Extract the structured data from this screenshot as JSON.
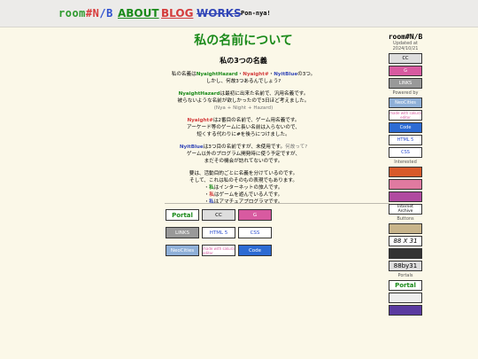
{
  "header": {
    "logo": [
      "room",
      "#N",
      "/B"
    ],
    "nav": [
      "ABOUT",
      "BLOG",
      "WORKS"
    ],
    "tagline": "Pon-nya!"
  },
  "main": {
    "title": "私の名前について",
    "subtitle": "私の3つの名義",
    "p1": [
      "私の名義は",
      "NyaightHazard",
      "・",
      "Nyaight#",
      "・",
      "NyitBlue",
      "の3つ。"
    ],
    "p1b": "しかし、何故3つあるんでしょう?",
    "p2a": [
      "NyaightHazard",
      "は最初に出来た名前で、汎用名義です。"
    ],
    "p2b": "被らないような名前が欲しかったので3日ほど考えました。",
    "p2c": "(Nya + Night + Hazard)",
    "p3a": [
      "Nyaight#",
      "は2番目の名前で、ゲーム用名義です。"
    ],
    "p3b": "アーケード等のゲームに長い名前は入らないので、",
    "p3c": "短くする代わりに#を後ろにつけました。",
    "p4a": [
      "NyitBlue",
      "は3つ目の名前ですが、未使用です。",
      "何故って?"
    ],
    "p4b": "ゲーム以外のプログラム開発時に使う予定ですが、",
    "p4c": "まだその機会が訪れてないのです。",
    "p5a": "要は、活動目的ごとに名義を分けているのです。",
    "p5b": "そして、これは私のそのもの表現でもあります。",
    "p5c": [
      "・",
      "私",
      "はインターネットの旅人です。"
    ],
    "p5d": [
      "・",
      "私",
      "はゲームを遊んでいる人です。"
    ],
    "p5e": [
      "・",
      "私",
      "はアマチュアプログラマです。"
    ]
  },
  "badges": [
    "Portal",
    "CC",
    "G",
    "LINKS",
    "HTML 5",
    "CSS",
    "NeoCities",
    "made with sakura editor",
    "Code"
  ],
  "sidebar": {
    "logo": "room#N/B",
    "updated_label": "Updated at",
    "updated_date": "2024/10/21",
    "powered_by": "Powered by",
    "interested": "Interested",
    "buttons": "Buttons",
    "portals": "Portals",
    "button_labels": [
      "88 X 31",
      "88by31"
    ],
    "ia": "Internet Archive"
  },
  "colors": {
    "green": "#1a8a1a",
    "red": "#d43b3b",
    "blue": "#3347b8",
    "bg": "#fbf8e8"
  }
}
